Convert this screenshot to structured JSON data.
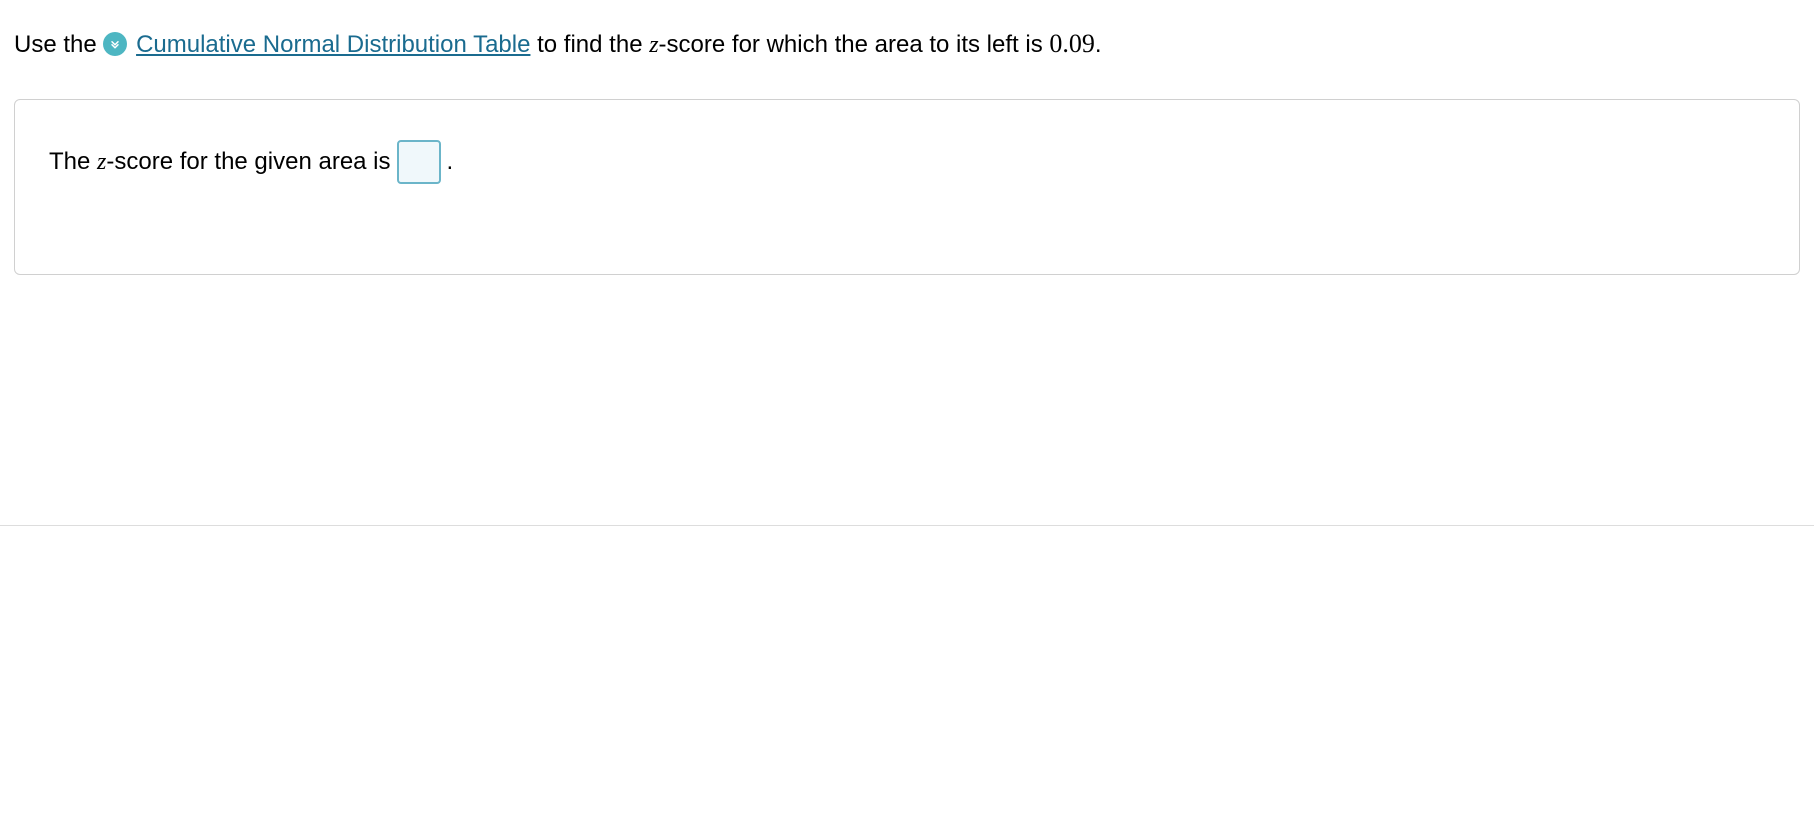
{
  "prompt": {
    "prefix": "Use the ",
    "link_text": "Cumulative Normal Distribution Table",
    "mid1": " to find the ",
    "var1": "z",
    "mid2": "-score for which the area to its left is ",
    "value": "0.09",
    "suffix": "."
  },
  "answer": {
    "prefix": "The ",
    "var": "z",
    "mid": "-score for the given area is ",
    "input_value": "",
    "suffix": "."
  }
}
